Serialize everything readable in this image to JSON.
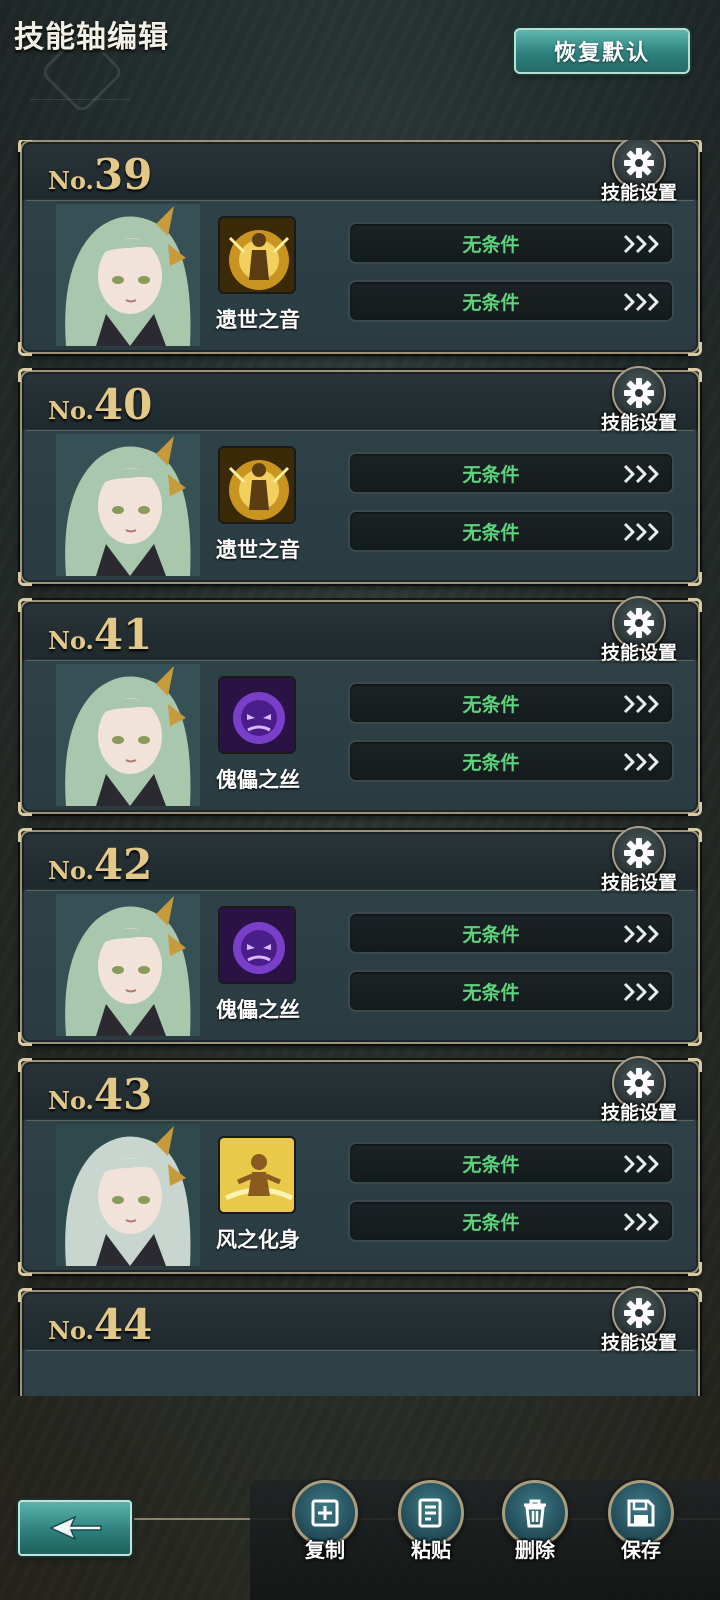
{
  "header": {
    "title": "技能轴编辑",
    "reset_label": "恢复默认"
  },
  "cards": [
    {
      "no_prefix": "No.",
      "number": "39",
      "settings_label": "技能设置",
      "skill_name": "遗世之音",
      "skill_icon": "golden-figure-skill-icon",
      "conditions": [
        "无条件",
        "无条件"
      ]
    },
    {
      "no_prefix": "No.",
      "number": "40",
      "settings_label": "技能设置",
      "skill_name": "遗世之音",
      "skill_icon": "golden-figure-skill-icon",
      "conditions": [
        "无条件",
        "无条件"
      ]
    },
    {
      "no_prefix": "No.",
      "number": "41",
      "settings_label": "技能设置",
      "skill_name": "傀儡之丝",
      "skill_icon": "purple-ghost-skill-icon",
      "conditions": [
        "无条件",
        "无条件"
      ]
    },
    {
      "no_prefix": "No.",
      "number": "42",
      "settings_label": "技能设置",
      "skill_name": "傀儡之丝",
      "skill_icon": "purple-ghost-skill-icon",
      "conditions": [
        "无条件",
        "无条件"
      ]
    },
    {
      "no_prefix": "No.",
      "number": "43",
      "settings_label": "技能设置",
      "skill_name": "风之化身",
      "skill_icon": "wind-avatar-skill-icon",
      "conditions": [
        "无条件",
        "无条件"
      ]
    },
    {
      "no_prefix": "No.",
      "number": "44",
      "settings_label": "技能设置"
    }
  ],
  "bottom_bar": {
    "actions": [
      {
        "label": "复制",
        "icon": "copy-icon"
      },
      {
        "label": "粘贴",
        "icon": "paste-icon"
      },
      {
        "label": "删除",
        "icon": "trash-icon"
      },
      {
        "label": "保存",
        "icon": "save-icon"
      }
    ]
  },
  "colors": {
    "condition_text": "#5fd37b",
    "card_number": "#e2c98a",
    "accent_teal": "#2e807c"
  }
}
